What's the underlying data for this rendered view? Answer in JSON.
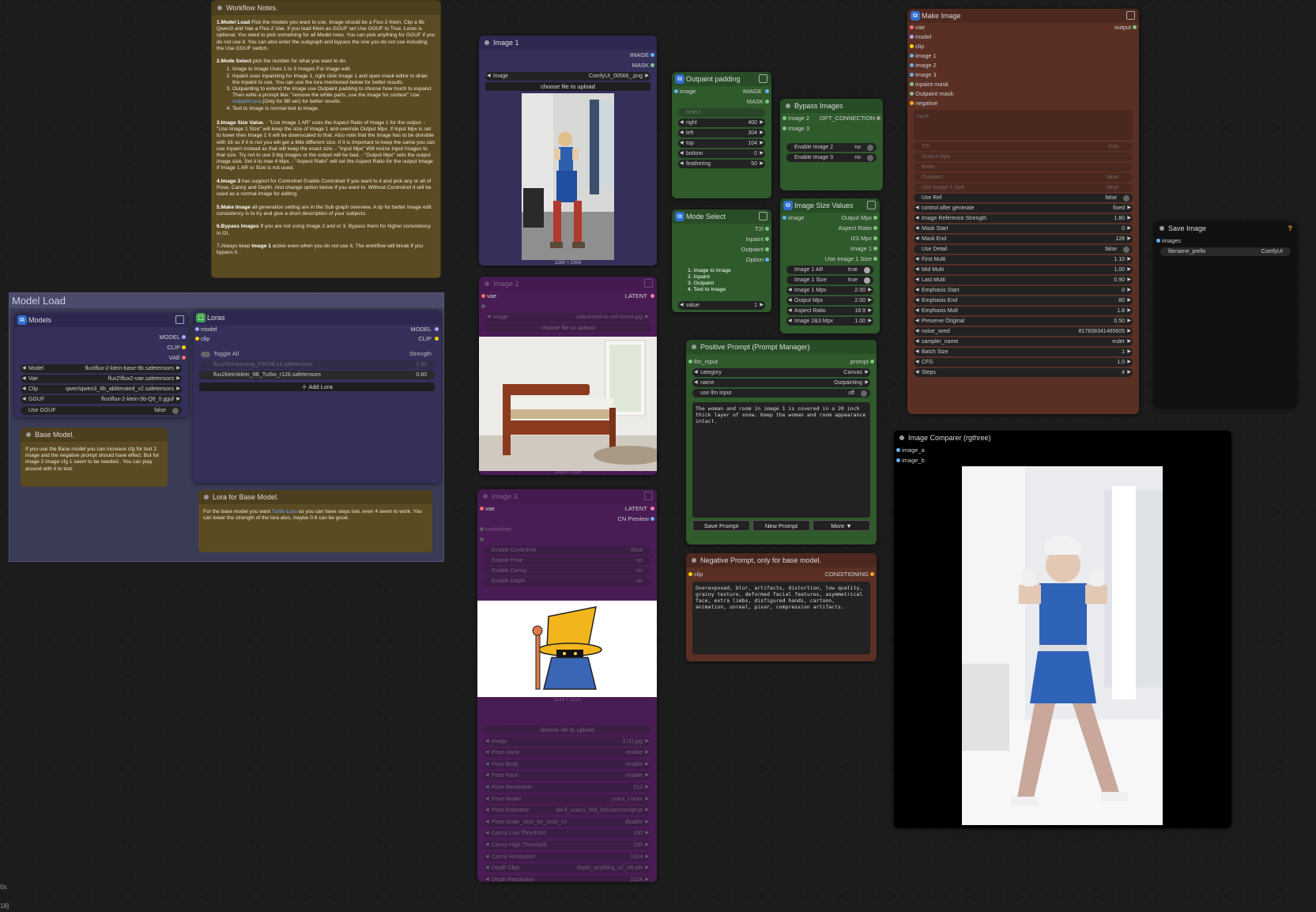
{
  "workflow_notes": {
    "title": "Workflow Notes.",
    "p1_head": "1.Model Load",
    "p1": " Pick the models you want to use. Image should be a Flux-2 Klein. Clip a 8b Qwen3 and Vae a Flux-2 Vae. If you load Klein as GGUF set Use GGUF to True. Loras is optional. You need to pick something for all Model rows. You can pick anything for GGUF if you do not use it. You can also enter the subgraph and bypass the one you do not use including the Use GGUF switch.",
    "p2_head": "2.Mode Select",
    "p2": " pick the number for what you want to do.",
    "p2_items": [
      "Image to Image Uses 1 to 3 Images For image edit.",
      "Inpaint uses Inpainting for Image 1, right click Image 1 and open mask editor to draw the Inpaint to use. You can use the lora mentioned below for better results.",
      "Outpainting to extend the image use Outpaint padding to choose how much to expand. Then write a prompt like: \"remove the white parts, use the image for context\" Use",
      "Text to Image is normal text to image."
    ],
    "p2_item3_link": "outpaint lora",
    "p2_item3_tail": " (Only for 9B ver) for better results.",
    "p3_head": "3.Image Size Value.",
    "p3": " - \"Use Image 1 AR\" uses the Aspect Ratio of Image 1 for the output. - \"Use Image 1 Size\" will keep the size of Image 1 and override Output Mpx. If Input Mpx is set to lower then Image 1 It will be downscaled to that. Also note that the Image has to be divisible with 16 so if it is not you will get a little different size. If it is Important to keep the same you can use Inpaint instead as that will keep the exact size. - \"Input Mpx\" Will resize Input Images to that size. Try not to use 3 big images or the output will be bad. - \"Output Mpx\" sets the output image size. Set it to max 4 Mpx. - \"Aspect Ratio\" will set the Aspect Ratio for the output Image If Image 1 AR or Size is not used.",
    "p4_head": "4.Image 3",
    "p4": " has support for Controlnet Enable Controlnet If you want to it and pick any or all of Pose, Canny and Depth. And change option below if you want to. Without Controlnet it will be used as a normal image for editing.",
    "p5_head": "5.Make Image",
    "p5": " all generation setting are in the Sub graph overview. A tip for better Image edit consistency is to try and give a short description of your subjects.",
    "p6_head": "6.Bypass Images",
    "p6": " If you are not using Image 2 and or 3. Bypass them for higher consistency in I2I.",
    "p7_a": "7.Always keep ",
    "p7_b": "Image 1",
    "p7_c": " active even when you do not use it. The workflow will break if you bypass it."
  },
  "model_load": {
    "title": "Model Load",
    "models": {
      "title": "Models",
      "outputs": [
        "MODEL",
        "CLIP",
        "VAE"
      ],
      "widgets": [
        {
          "label": "Model",
          "value": "flux\\flux-2-klein-base-9b.safetensors"
        },
        {
          "label": "Vae",
          "value": "flux2\\flux2-vae.safetensors"
        },
        {
          "label": "Clip",
          "value": "qwen\\qwen3_8b_abliterated_v2.safetensors"
        },
        {
          "label": "GGUF",
          "value": "flux\\flux-2-klein-9b-Q8_0.gguf"
        }
      ],
      "use_gguf_label": "Use GGUF",
      "use_gguf_value": "false"
    },
    "loras": {
      "title": "Loras",
      "inputs": [
        "model",
        "clip"
      ],
      "outputs": [
        "MODEL",
        "CLIP"
      ],
      "toggle_all": "Toggle All",
      "strength_header": "Strength",
      "items": [
        {
          "name": "flux2klein\\uncrop_F2K9B.s1.safetensors",
          "strength": "1.00",
          "enabled": false
        },
        {
          "name": "flux2klein\\klein_9B_Turbo_r128.safetensors",
          "strength": "0.60",
          "enabled": true
        }
      ],
      "add_lora": "Add Lora"
    },
    "base_note": {
      "title": "Base Model.",
      "text": "If you use the Base model you can increase cfg for text 2 image and the negative prompt should have effect. But for image 2 image cfg 1 seem to be needed.. You can play around with it to test."
    },
    "lora_note": {
      "title": "Lora for Base Model.",
      "text_a": "For the base model you want ",
      "link": "Turbo Lora",
      "text_b": " so you can have steps low, even 4 seem to work. You can lower the strength of the lora also, maybe 0.6 can be good."
    }
  },
  "image1": {
    "title": "Image 1",
    "outputs": [
      "IMAGE",
      "MASK"
    ],
    "image_label": "image",
    "image_value": "ComfyUI_00566_.png",
    "upload": "choose file to upload",
    "dims": "1280 × 2304"
  },
  "image2": {
    "title": "Image 2",
    "input": "vae",
    "output": "LATENT",
    "image_label": "image",
    "image_value": "oxford-bed-in-red-forest.jpg",
    "upload": "choose file to upload",
    "dims": "2048 × 1536"
  },
  "image3": {
    "title": "Image 3",
    "input": "vae",
    "outputs": [
      "LATENT",
      "CN Preview"
    ],
    "input2": "controlnet",
    "toggles": [
      {
        "label": "Enable Controlnet",
        "value": "false"
      },
      {
        "label": "Enable Pose",
        "value": "no"
      },
      {
        "label": "Enable Canny",
        "value": "no"
      },
      {
        "label": "Enable Depth",
        "value": "no"
      }
    ],
    "dims": "1024 × 1024",
    "upload": "choose file to upload",
    "widgets": [
      {
        "label": "image",
        "value": "3 (1).jpg"
      },
      {
        "label": "Pose Hand",
        "value": "enable"
      },
      {
        "label": "Pose Body",
        "value": "enable"
      },
      {
        "label": "Pose Face",
        "value": "enable"
      },
      {
        "label": "Pose Resolution",
        "value": "512"
      },
      {
        "label": "Pose Model",
        "value": "yolox_l.onnx"
      },
      {
        "label": "Pose Estimator",
        "value": "dw-ll_ucoco_384_bs5.torchscript.pt"
      },
      {
        "label": "Pose Scale_stick_for_xinsr_cn",
        "value": "disable"
      },
      {
        "label": "Canny Low Threshold",
        "value": "100"
      },
      {
        "label": "Canny High Threshold",
        "value": "200"
      },
      {
        "label": "Canny Resolution",
        "value": "1024"
      },
      {
        "label": "Depth Ckpt",
        "value": "depth_anything_v2_vitl.pth"
      },
      {
        "label": "Depth Resolution",
        "value": "1024"
      }
    ]
  },
  "outpaint": {
    "title": "Outpaint padding",
    "inputs": [
      "image",
      "select"
    ],
    "outputs": [
      "IMAGE",
      "MASK"
    ],
    "widgets": [
      {
        "label": "right",
        "value": "400"
      },
      {
        "label": "left",
        "value": "304"
      },
      {
        "label": "top",
        "value": "104"
      },
      {
        "label": "bottom",
        "value": "0"
      },
      {
        "label": "feathering",
        "value": "50"
      }
    ]
  },
  "mode_select": {
    "title": "Mode Select",
    "outputs": [
      "T2I",
      "Inpaint",
      "Outpaint",
      "Option"
    ],
    "items": [
      "1. Image to Image",
      "2. Inpaint",
      "3. Outpaint",
      "4. Text to Image"
    ],
    "value_label": "value",
    "value": "1"
  },
  "bypass": {
    "title": "Bypass Images",
    "inputs": [
      "Image 2",
      "Image 3"
    ],
    "output": "OPT_CONNECTION",
    "toggles": [
      {
        "label": "Enable Image 2",
        "value": "no"
      },
      {
        "label": "Enable Image 3",
        "value": "no"
      }
    ]
  },
  "size_values": {
    "title": "Image Size Values",
    "input": "image",
    "outputs": [
      "Output Mpx",
      "Aspect Ratio",
      "I23 Mpx",
      "Image 1",
      "Use Image 1 Size"
    ],
    "toggles": [
      {
        "label": "Image 1 AR",
        "value": "true"
      },
      {
        "label": "Image 1 Size",
        "value": "true"
      }
    ],
    "widgets": [
      {
        "label": "Image 1 Mpx",
        "value": "2.00"
      },
      {
        "label": "Output Mpx",
        "value": "2.00"
      },
      {
        "label": "Aspect Ratio",
        "value": "16:9"
      },
      {
        "label": "Image 2&3 Mpx",
        "value": "1.00"
      }
    ]
  },
  "positive": {
    "title": "Positive Prompt (Prompt Manager)",
    "input": "llm_input",
    "output": "prompt",
    "widgets": [
      {
        "label": "category",
        "value": "Canvas"
      },
      {
        "label": "name",
        "value": "Outpainting"
      }
    ],
    "use_llm_label": "use llm input",
    "use_llm_value": "off",
    "text": "The woman and room in image 1 is covered in a 20 inch thick layer of snow. Keep the woman and room appearance intact.",
    "buttons": [
      "Save Prompt",
      "New Prompt",
      "More ▼"
    ]
  },
  "negative": {
    "title": "Negative Prompt, only for base model.",
    "input": "clip",
    "output": "CONDITIONING",
    "text": "Overexposed, blur, artifacts, distortion, low quality, grainy texture, deformed facial features, asymmetrical face, extra limbs, disfigured hands, cartoon, animation, unreal, pixar, compression artifacts."
  },
  "make_image": {
    "title": "Make Image",
    "output": "output",
    "inputs": [
      "vae",
      "model",
      "clip",
      "image 1",
      "image 2",
      "image 3",
      "inpaint mask",
      "Outpaint mask",
      "negative"
    ],
    "text_placeholder": "text",
    "dim_inputs": [
      {
        "label": "T2I",
        "value": "true"
      },
      {
        "label": "Output Mpx",
        "value": ""
      },
      {
        "label": "Ratio",
        "value": ""
      },
      {
        "label": "Outpaint",
        "value": "false"
      },
      {
        "label": "Use Image 1 size",
        "value": "false"
      }
    ],
    "widgets": [
      {
        "label": "Use Ref",
        "value": "false",
        "toggle": true
      },
      {
        "label": "control after generate",
        "value": "fixed"
      },
      {
        "label": "Image Reference Strength",
        "value": "1.80"
      },
      {
        "label": "Mask Start",
        "value": "0"
      },
      {
        "label": "Mask End",
        "value": "128"
      },
      {
        "label": "Use Detail",
        "value": "false",
        "toggle": true
      },
      {
        "label": "First Multi",
        "value": "1.10"
      },
      {
        "label": "Mid Multi",
        "value": "1.00"
      },
      {
        "label": "Last Multi",
        "value": "0.90"
      },
      {
        "label": "Emphasis Start",
        "value": "0"
      },
      {
        "label": "Emphasis End",
        "value": "80"
      },
      {
        "label": "Emphasis Mult",
        "value": "1.8"
      },
      {
        "label": "Preserve Original",
        "value": "0.50"
      },
      {
        "label": "noise_seed",
        "value": "817838341465605"
      },
      {
        "label": "sampler_name",
        "value": "euler"
      },
      {
        "label": "Batch Size",
        "value": "1"
      },
      {
        "label": "CFG",
        "value": "1.0"
      },
      {
        "label": "Steps",
        "value": "4"
      }
    ]
  },
  "save_image": {
    "title": "Save Image",
    "badge": "?",
    "input": "images",
    "prefix_label": "filename_prefix",
    "prefix_value": "ComfyUI"
  },
  "comparer": {
    "title": "Image Comparer (rgthree)",
    "inputs": [
      "image_a",
      "image_b"
    ]
  },
  "status": {
    "a": "0s",
    "b": "18]"
  },
  "colors": {
    "canvas": "#1c1c1c",
    "note": "#5b4b23",
    "purple": "#35305a",
    "green": "#2f5a2c",
    "brown": "#5a3025",
    "magenta": "#4a1c55"
  }
}
